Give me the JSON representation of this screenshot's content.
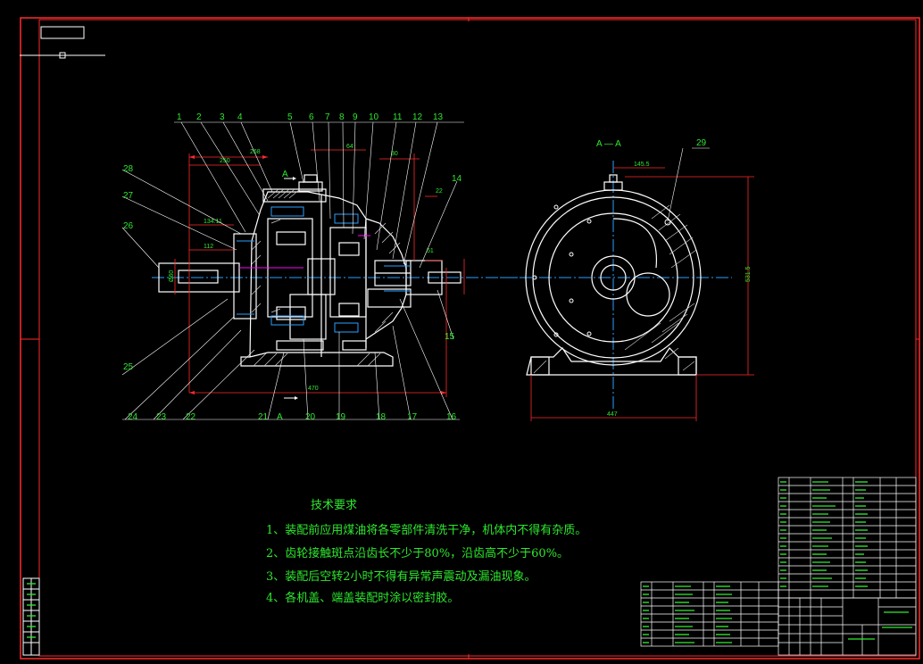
{
  "section_mark": "A",
  "section_title": "A — A",
  "balloons_top": [
    "1",
    "2",
    "3",
    "4",
    "5",
    "6",
    "7",
    "8",
    "9",
    "10",
    "11",
    "12",
    "13"
  ],
  "balloons_bottom": [
    "24",
    "23",
    "22",
    "21",
    "20",
    "19",
    "18",
    "17",
    "16"
  ],
  "balloons_left": [
    "28",
    "27",
    "26",
    "25"
  ],
  "balloons_right": [
    "14",
    "15",
    "29"
  ],
  "dims": {
    "d_268": "268",
    "d_250": "250",
    "d_64": "64",
    "d_80": "80",
    "d_134": "134.11",
    "d_112": "112",
    "d_470": "470",
    "d_60": "Ø60",
    "d_22": "22",
    "d_51": "51",
    "d_145": "145.5",
    "d_531": "531.5",
    "d_447": "447"
  },
  "tech": {
    "title": "技术要求",
    "items": [
      "1、装配前应用煤油将各零部件清洗干净，机体内不得有杂质。",
      "2、齿轮接触斑点沿齿长不少于80%，沿齿高不少于60%。",
      "3、装配后空转2小时不得有异常声震动及漏油现象。",
      "4、各机盖、端盖装配时涂以密封胶。"
    ]
  },
  "colors": {
    "frame": "#ff2a2a",
    "drawing": "#ffffff",
    "text": "#2ee82e",
    "center": "#2aa0ff",
    "hatch": "#d0d0d0",
    "accent": "#ff00ff"
  }
}
